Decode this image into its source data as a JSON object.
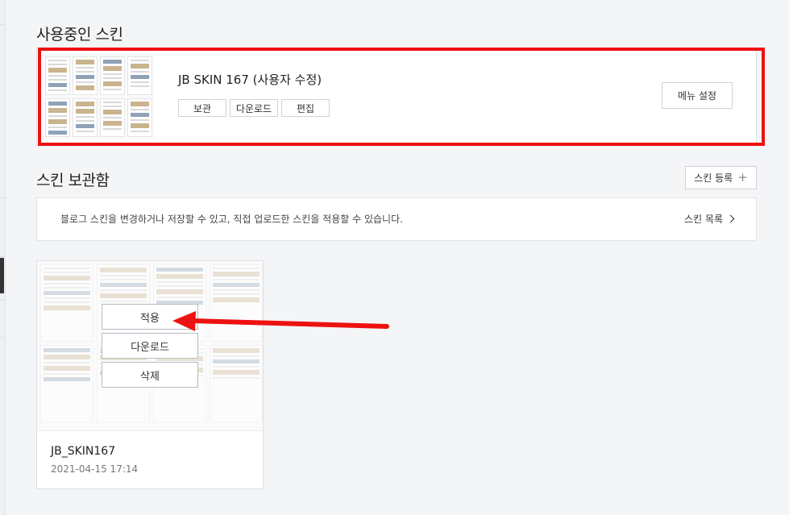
{
  "current_section": {
    "title": "사용중인 스킨",
    "skin_name": "JB SKIN 167 (사용자 수정)",
    "buttons": {
      "archive": "보관",
      "download": "다운로드",
      "edit": "편집"
    },
    "menu_settings": "메뉴 설정"
  },
  "storage_section": {
    "title": "스킨 보관함",
    "register_label": "스킨 등록",
    "register_icon": "+",
    "info_text": "블로그 스킨을 변경하거나 저장할 수 있고, 직접 업로드한 스킨을 적용할 수 있습니다.",
    "list_link": "스킨 목록"
  },
  "skin_card": {
    "name": "JB_SKIN167",
    "date": "2021-04-15 17:14",
    "actions": {
      "apply": "적용",
      "download": "다운로드",
      "delete": "삭제"
    }
  },
  "colors": {
    "highlight": "#ee1111",
    "arrow": "#ee1111"
  }
}
